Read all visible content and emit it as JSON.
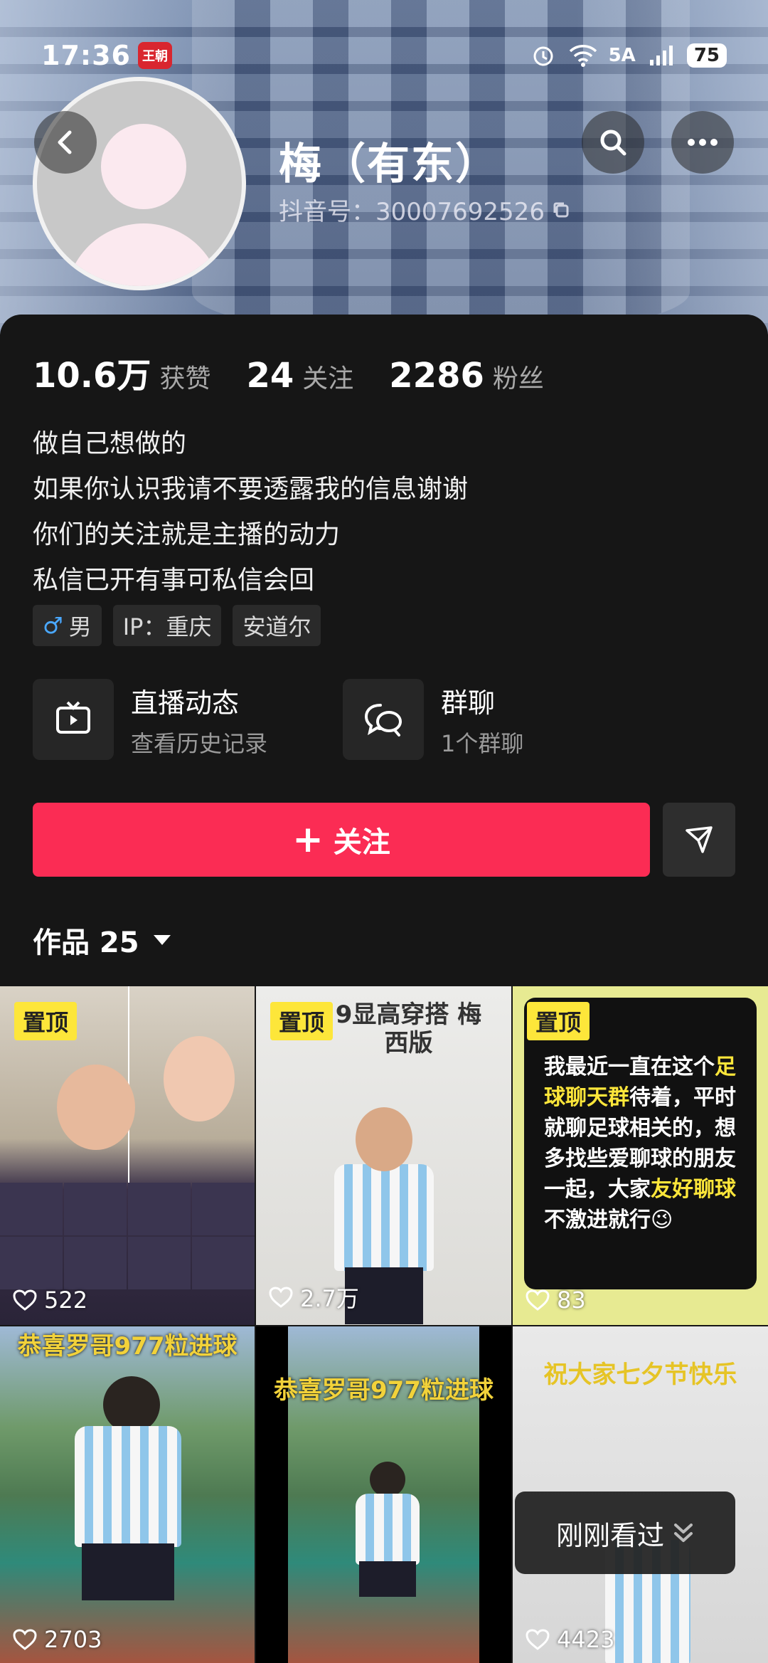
{
  "status_bar": {
    "time": "17:36",
    "badge": "王朝",
    "network": "5A",
    "battery": "75"
  },
  "profile": {
    "name": "梅（有东）",
    "douyin_id": "抖音号：30007692526"
  },
  "stats": [
    {
      "num": "10.6万",
      "label": "获赞"
    },
    {
      "num": "24",
      "label": "关注"
    },
    {
      "num": "2286",
      "label": "粉丝"
    }
  ],
  "bio": [
    "做自己想做的",
    "如果你认识我请不要透露我的信息谢谢",
    "你们的关注就是主播的动力",
    "私信已开有事可私信会回"
  ],
  "tags": {
    "gender_symbol": "♂",
    "gender": "男",
    "ip": "IP：重庆",
    "other": "安道尔"
  },
  "features": {
    "live": {
      "title": "直播动态",
      "sub": "查看历史记录"
    },
    "group": {
      "title": "群聊",
      "sub": "1个群聊"
    }
  },
  "actions": {
    "follow": "关注"
  },
  "works": {
    "label": "作品 25"
  },
  "grid": [
    {
      "pin": "置顶",
      "likes": "522",
      "caption": ""
    },
    {
      "pin": "置顶",
      "likes": "2.7万",
      "caption": "9显高穿搭 梅西版"
    },
    {
      "pin": "置顶",
      "likes": "83",
      "caption": ""
    },
    {
      "pin": "",
      "likes": "2703",
      "caption": "恭喜罗哥977粒进球"
    },
    {
      "pin": "",
      "likes": "",
      "caption": "恭喜罗哥977粒进球"
    },
    {
      "pin": "",
      "likes": "4423",
      "caption": "祝大家七夕节快乐"
    }
  ],
  "c3_text": {
    "p1": "我最近一直在这个",
    "hl1": "足球聊天群",
    "p2": "待着，平时就聊足球相关的，想多找些爱聊球的朋友一起，大家",
    "hl2": "友好聊球",
    "p3": "不激进就行😉"
  },
  "recent": {
    "label": "刚刚看过"
  }
}
